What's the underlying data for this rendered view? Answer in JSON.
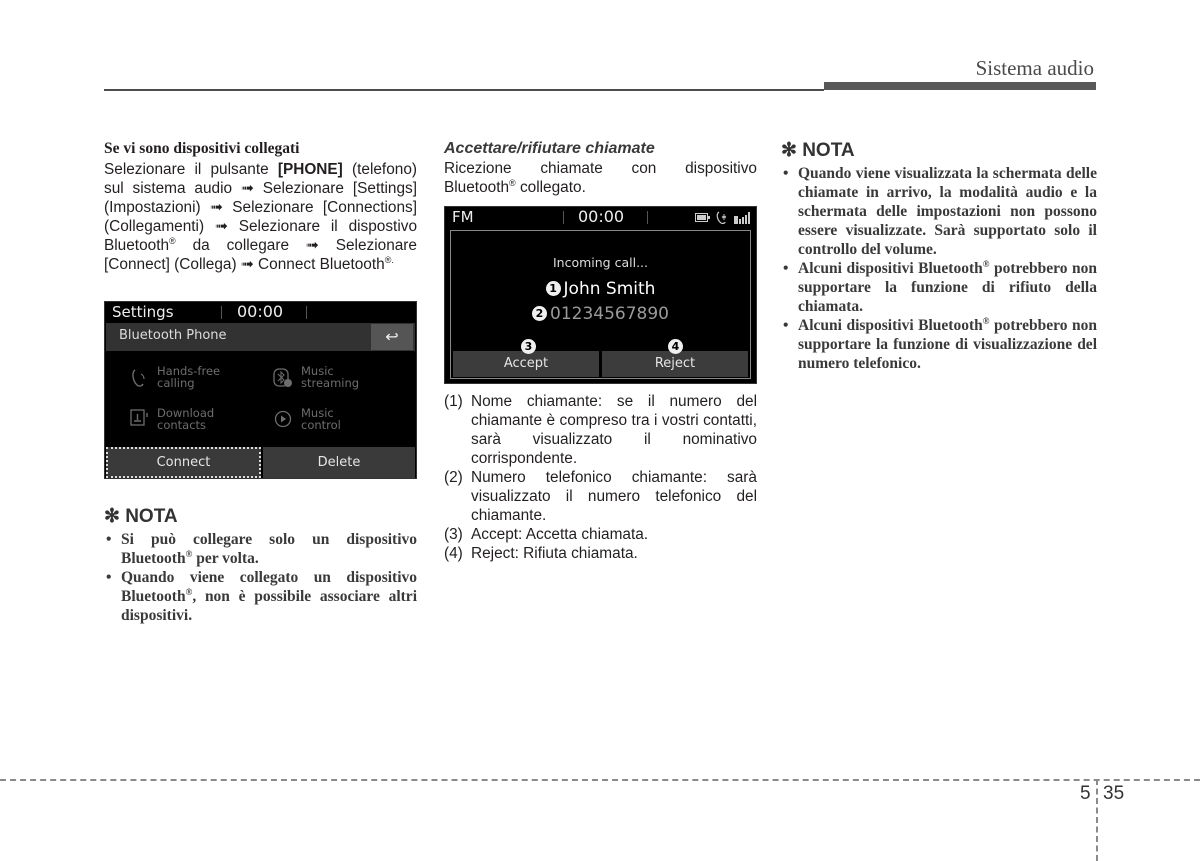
{
  "header": {
    "section_title": "Sistema audio"
  },
  "column1": {
    "heading": "Se vi sono dispositivi collegati",
    "para": {
      "t1": "Selezionare il pulsante ",
      "key": "[PHONE]",
      "t2": " (telefono) sul sistema audio ",
      "arrow": "➟",
      "t3": " Selezionare [Settings] (Impostazioni) ",
      "t4": " Selezionare [Connections] (Collegamenti) ",
      "t5": " Selezionare il dispostivo Bluetooth",
      "reg": "®",
      "t6": " da collegare ",
      "t7": " Selezionare [Connect] (Collega) ",
      "t8": " Connect Bluetooth",
      "t9": "."
    },
    "settings_screen": {
      "status_left": "Settings",
      "time": "00:00",
      "title": "Bluetooth Phone",
      "back_icon": "↩",
      "features": [
        {
          "icon": "phone-handsfree-icon",
          "line1": "Hands-free",
          "line2": "calling"
        },
        {
          "icon": "bluetooth-music-icon",
          "line1": "Music",
          "line2": "streaming"
        },
        {
          "icon": "download-contacts-icon",
          "line1": "Download",
          "line2": "contacts"
        },
        {
          "icon": "play-circle-icon",
          "line1": "Music",
          "line2": "control"
        }
      ],
      "buttons": {
        "connect": "Connect",
        "delete": "Delete"
      }
    },
    "nota": {
      "symbol": "✻",
      "title": "NOTA",
      "items": [
        {
          "a": "Si può collegare solo un dispositivo Bluetooth",
          "reg": "®",
          "b": " per volta."
        },
        {
          "a": "Quando viene collegato un dispositivo Bluetooth",
          "reg": "®",
          "b": ", non è possibile associare altri dispositivi."
        }
      ]
    }
  },
  "column2": {
    "heading": "Accettare/rifiutare chiamate",
    "intro": {
      "a": "Ricezione chiamate con dispositivo Bluetooth",
      "reg": "®",
      "b": " collegato."
    },
    "call_screen": {
      "status_left": "FM",
      "time": "00:00",
      "status_icons": [
        "battery-icon",
        "bluetooth-phone-icon",
        "signal-icon"
      ],
      "incoming": "Incoming call...",
      "caller_name": "John Smith",
      "caller_number": "01234567890",
      "markers": [
        "1",
        "2",
        "3",
        "4"
      ],
      "buttons": {
        "accept": "Accept",
        "reject": "Reject"
      }
    },
    "legend": [
      {
        "num": "(1)",
        "text": "Nome chiamante: se il numero del chiamante è compreso tra i vostri contatti, sarà visualizzato il nominativo corrispondente."
      },
      {
        "num": "(2)",
        "text": "Numero telefonico chiamante: sarà visualizzato il numero telefonico del chiamante."
      },
      {
        "num": "(3)",
        "text": "Accept: Accetta chiamata."
      },
      {
        "num": "(4)",
        "text": "Reject: Rifiuta chiamata."
      }
    ]
  },
  "column3": {
    "nota": {
      "symbol": "✻",
      "title": "NOTA",
      "items": [
        {
          "a": "Quando viene visualizzata la schermata delle chiamate in arrivo, la modalità audio e la schermata delle impostazioni non possono essere visualizzate. Sarà supportato solo il controllo del volume.",
          "reg": "",
          "b": ""
        },
        {
          "a": "Alcuni dispositivi Bluetooth",
          "reg": "®",
          "b": " potrebbero non supportare la funzione di rifiuto della chiamata."
        },
        {
          "a": "Alcuni dispositivi Bluetooth",
          "reg": "®",
          "b": " potrebbero non supportare la funzione di visualizzazione del numero telefonico."
        }
      ]
    }
  },
  "footer": {
    "chapter": "5",
    "page": "35"
  }
}
